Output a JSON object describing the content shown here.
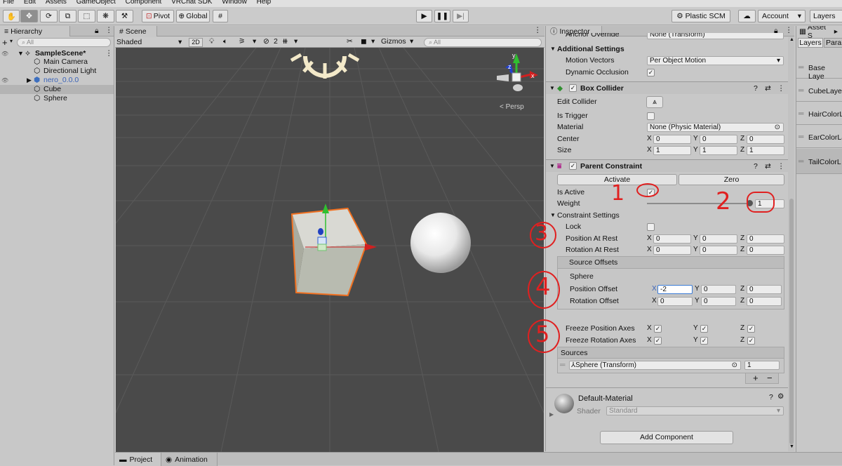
{
  "menu": [
    "File",
    "Edit",
    "Assets",
    "GameObject",
    "Component",
    "VRChat SDK",
    "Window",
    "Help"
  ],
  "toolbar": {
    "pivot": "Pivot",
    "global": "Global",
    "plastic": "Plastic SCM",
    "account": "Account",
    "layers": "Layers"
  },
  "hierarchy": {
    "tab": "Hierarchy",
    "search_placeholder": "All",
    "scene": "SampleScene*",
    "items": [
      "Main Camera",
      "Directional Light",
      "nero_0.0.0",
      "Cube",
      "Sphere"
    ]
  },
  "scene": {
    "tab": "Scene",
    "shading": "Shaded",
    "mode2d": "2D",
    "hidden_count": "2",
    "gizmos": "Gizmos",
    "search_placeholder": "All",
    "persp": "Persp",
    "axis_y": "y",
    "axis_x": "x",
    "axis_z": "z"
  },
  "inspector": {
    "tab": "Inspector",
    "anchor_label": "Anchor Override",
    "anchor_value": "None (Transform)",
    "additional_settings": "Additional Settings",
    "motion_vectors_label": "Motion Vectors",
    "motion_vectors_value": "Per Object Motion",
    "dynamic_occlusion_label": "Dynamic Occlusion",
    "box_collider": {
      "title": "Box Collider",
      "edit_collider": "Edit Collider",
      "is_trigger": "Is Trigger",
      "material_label": "Material",
      "material_value": "None (Physic Material)",
      "center_label": "Center",
      "size_label": "Size",
      "center": {
        "x": "0",
        "y": "0",
        "z": "0"
      },
      "size": {
        "x": "1",
        "y": "1",
        "z": "1"
      }
    },
    "parent_constraint": {
      "title": "Parent Constraint",
      "activate": "Activate",
      "zero": "Zero",
      "is_active": "Is Active",
      "weight_label": "Weight",
      "weight_value": "1",
      "weight_fraction": 1.0,
      "constraint_settings": "Constraint Settings",
      "lock": "Lock",
      "position_at_rest": "Position At Rest",
      "rotation_at_rest": "Rotation At Rest",
      "par": {
        "x": "0",
        "y": "0",
        "z": "0"
      },
      "rar": {
        "x": "0",
        "y": "0",
        "z": "0"
      },
      "source_offsets": "Source Offsets",
      "source_name": "Sphere",
      "position_offset": "Position Offset",
      "rotation_offset": "Rotation Offset",
      "po": {
        "x": "-2",
        "y": "0",
        "z": "0"
      },
      "ro": {
        "x": "0",
        "y": "0",
        "z": "0"
      },
      "freeze_position": "Freeze Position Axes",
      "freeze_rotation": "Freeze Rotation Axes",
      "axis_x": "X",
      "axis_y": "Y",
      "axis_z": "Z",
      "sources": "Sources",
      "source_item": "Sphere (Transform)",
      "source_weight": "1"
    },
    "material": {
      "name": "Default-Material",
      "shader_label": "Shader",
      "shader_value": "Standard"
    },
    "add_component": "Add Component"
  },
  "asset_store": {
    "tab": "Asset S",
    "tab_layers": "Layers",
    "tab_params": "Para",
    "items": [
      "Base Laye",
      "CubeLaye",
      "HairColorL",
      "EarColorLa",
      "TailColorL"
    ]
  },
  "bottom": {
    "project": "Project",
    "animation": "Animation"
  },
  "annotations": [
    "1",
    "2",
    "3",
    "4",
    "5"
  ],
  "colors": {
    "annotation": "#e02020",
    "selection_outline": "#f07020",
    "scene_bg": "#4a4a4a"
  }
}
